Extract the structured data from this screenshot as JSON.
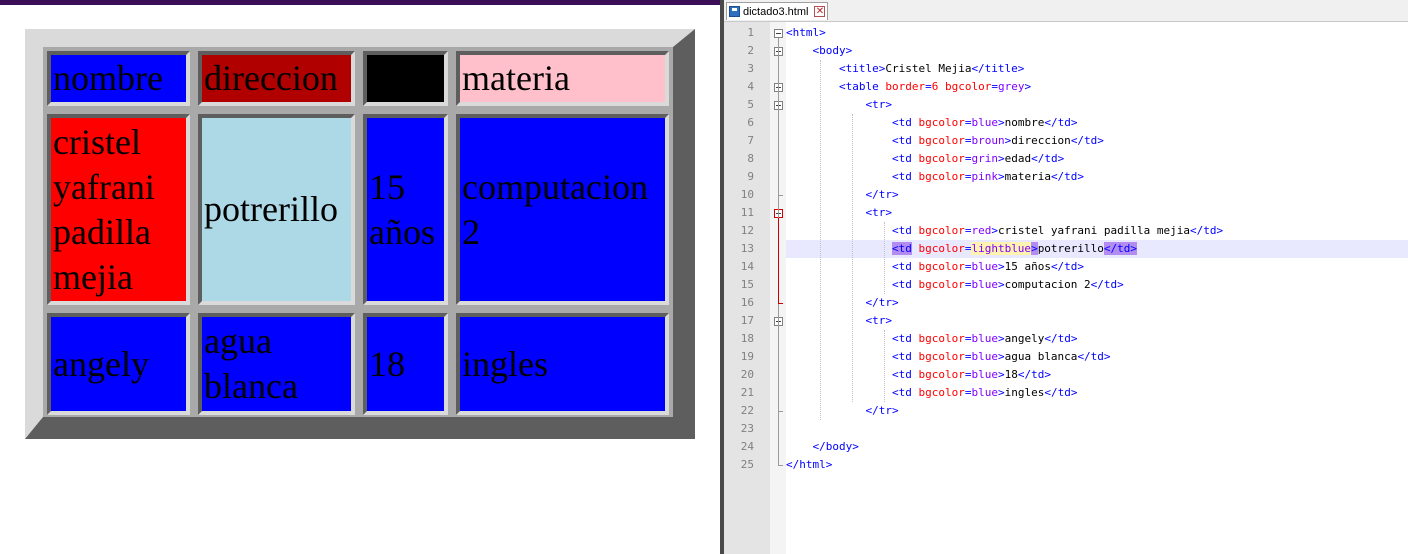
{
  "rendered_table": {
    "rows": [
      [
        {
          "text": "nombre",
          "bg": "#0000ff"
        },
        {
          "text": "direccion",
          "bg": "#b00000"
        },
        {
          "text": "",
          "bg": "#000000"
        },
        {
          "text": "materia",
          "bg": "#ffc0cb"
        }
      ],
      [
        {
          "text": "cristel\nyafrani\npadilla\nmejia",
          "bg": "#ff0000"
        },
        {
          "text": "potrerillo",
          "bg": "#add8e6"
        },
        {
          "text": "15\naños",
          "bg": "#0000ff"
        },
        {
          "text": "computacion\n2",
          "bg": "#0000ff"
        }
      ],
      [
        {
          "text": "angely",
          "bg": "#0000ff"
        },
        {
          "text": "agua\nblanca",
          "bg": "#0000ff"
        },
        {
          "text": "18",
          "bg": "#0000ff"
        },
        {
          "text": "ingles",
          "bg": "#0000ff"
        }
      ]
    ]
  },
  "editor": {
    "tab_title": "dictado3.html",
    "current_line": 13,
    "lines": [
      {
        "n": "1",
        "segs": [
          {
            "t": "<html>",
            "c": "tag"
          }
        ]
      },
      {
        "n": "2",
        "segs": [
          {
            "t": "    "
          },
          {
            "t": "<body>",
            "c": "tag"
          }
        ]
      },
      {
        "n": "3",
        "segs": [
          {
            "t": "        "
          },
          {
            "t": "<title>",
            "c": "tag"
          },
          {
            "t": "Cristel Mejia"
          },
          {
            "t": "</title>",
            "c": "tag"
          }
        ]
      },
      {
        "n": "4",
        "segs": [
          {
            "t": "        "
          },
          {
            "t": "<table ",
            "c": "tag"
          },
          {
            "t": "border",
            "c": "attr"
          },
          {
            "t": "=",
            "c": "tag"
          },
          {
            "t": "6",
            "c": "attr"
          },
          {
            "t": " ",
            "c": "tag"
          },
          {
            "t": "bgcolor",
            "c": "attr"
          },
          {
            "t": "=",
            "c": "tag"
          },
          {
            "t": "grey",
            "c": "val"
          },
          {
            "t": ">",
            "c": "tag"
          }
        ]
      },
      {
        "n": "5",
        "segs": [
          {
            "t": "            "
          },
          {
            "t": "<tr>",
            "c": "tag"
          }
        ]
      },
      {
        "n": "6",
        "segs": [
          {
            "t": "                "
          },
          {
            "t": "<td ",
            "c": "tag"
          },
          {
            "t": "bgcolor",
            "c": "attr"
          },
          {
            "t": "=",
            "c": "tag"
          },
          {
            "t": "blue",
            "c": "val"
          },
          {
            "t": ">",
            "c": "tag"
          },
          {
            "t": "nombre"
          },
          {
            "t": "</td>",
            "c": "tag"
          }
        ]
      },
      {
        "n": "7",
        "segs": [
          {
            "t": "                "
          },
          {
            "t": "<td ",
            "c": "tag"
          },
          {
            "t": "bgcolor",
            "c": "attr"
          },
          {
            "t": "=",
            "c": "tag"
          },
          {
            "t": "broun",
            "c": "val"
          },
          {
            "t": ">",
            "c": "tag"
          },
          {
            "t": "direccion"
          },
          {
            "t": "</td>",
            "c": "tag"
          }
        ]
      },
      {
        "n": "8",
        "segs": [
          {
            "t": "                "
          },
          {
            "t": "<td ",
            "c": "tag"
          },
          {
            "t": "bgcolor",
            "c": "attr"
          },
          {
            "t": "=",
            "c": "tag"
          },
          {
            "t": "grin",
            "c": "val"
          },
          {
            "t": ">",
            "c": "tag"
          },
          {
            "t": "edad"
          },
          {
            "t": "</td>",
            "c": "tag"
          }
        ]
      },
      {
        "n": "9",
        "segs": [
          {
            "t": "                "
          },
          {
            "t": "<td ",
            "c": "tag"
          },
          {
            "t": "bgcolor",
            "c": "attr"
          },
          {
            "t": "=",
            "c": "tag"
          },
          {
            "t": "pink",
            "c": "val"
          },
          {
            "t": ">",
            "c": "tag"
          },
          {
            "t": "materia"
          },
          {
            "t": "</td>",
            "c": "tag"
          }
        ]
      },
      {
        "n": "10",
        "segs": [
          {
            "t": "            "
          },
          {
            "t": "</tr>",
            "c": "tag"
          }
        ]
      },
      {
        "n": "11",
        "segs": [
          {
            "t": "            "
          },
          {
            "t": "<tr>",
            "c": "tag"
          }
        ]
      },
      {
        "n": "12",
        "segs": [
          {
            "t": "                "
          },
          {
            "t": "<td ",
            "c": "tag"
          },
          {
            "t": "bgcolor",
            "c": "attr"
          },
          {
            "t": "=",
            "c": "tag"
          },
          {
            "t": "red",
            "c": "val"
          },
          {
            "t": ">",
            "c": "tag"
          },
          {
            "t": "cristel yafrani padilla mejia"
          },
          {
            "t": "</td>",
            "c": "tag"
          }
        ]
      },
      {
        "n": "13",
        "segs": [
          {
            "t": "                "
          },
          {
            "t": "<td",
            "c": "tag-hl"
          },
          {
            "t": " ",
            "c": "tag"
          },
          {
            "t": "bgcolor",
            "c": "attr"
          },
          {
            "t": "=",
            "c": "tag"
          },
          {
            "t": "lightblue",
            "c": "val"
          },
          {
            "t": ">",
            "c": "tag-hl"
          },
          {
            "t": "potrerillo"
          },
          {
            "t": "</td>",
            "c": "tag-hl"
          }
        ]
      },
      {
        "n": "14",
        "segs": [
          {
            "t": "                "
          },
          {
            "t": "<td ",
            "c": "tag"
          },
          {
            "t": "bgcolor",
            "c": "attr"
          },
          {
            "t": "=",
            "c": "tag"
          },
          {
            "t": "blue",
            "c": "val"
          },
          {
            "t": ">",
            "c": "tag"
          },
          {
            "t": "15 años"
          },
          {
            "t": "</td>",
            "c": "tag"
          }
        ]
      },
      {
        "n": "15",
        "segs": [
          {
            "t": "                "
          },
          {
            "t": "<td ",
            "c": "tag"
          },
          {
            "t": "bgcolor",
            "c": "attr"
          },
          {
            "t": "=",
            "c": "tag"
          },
          {
            "t": "blue",
            "c": "val"
          },
          {
            "t": ">",
            "c": "tag"
          },
          {
            "t": "computacion 2"
          },
          {
            "t": "</td>",
            "c": "tag"
          }
        ]
      },
      {
        "n": "16",
        "segs": [
          {
            "t": "            "
          },
          {
            "t": "</tr>",
            "c": "tag"
          }
        ]
      },
      {
        "n": "17",
        "segs": [
          {
            "t": "            "
          },
          {
            "t": "<tr>",
            "c": "tag"
          }
        ]
      },
      {
        "n": "18",
        "segs": [
          {
            "t": "                "
          },
          {
            "t": "<td ",
            "c": "tag"
          },
          {
            "t": "bgcolor",
            "c": "attr"
          },
          {
            "t": "=",
            "c": "tag"
          },
          {
            "t": "blue",
            "c": "val"
          },
          {
            "t": ">",
            "c": "tag"
          },
          {
            "t": "angely"
          },
          {
            "t": "</td>",
            "c": "tag"
          }
        ]
      },
      {
        "n": "19",
        "segs": [
          {
            "t": "                "
          },
          {
            "t": "<td ",
            "c": "tag"
          },
          {
            "t": "bgcolor",
            "c": "attr"
          },
          {
            "t": "=",
            "c": "tag"
          },
          {
            "t": "blue",
            "c": "val"
          },
          {
            "t": ">",
            "c": "tag"
          },
          {
            "t": "agua blanca"
          },
          {
            "t": "</td>",
            "c": "tag"
          }
        ]
      },
      {
        "n": "20",
        "segs": [
          {
            "t": "                "
          },
          {
            "t": "<td ",
            "c": "tag"
          },
          {
            "t": "bgcolor",
            "c": "attr"
          },
          {
            "t": "=",
            "c": "tag"
          },
          {
            "t": "blue",
            "c": "val"
          },
          {
            "t": ">",
            "c": "tag"
          },
          {
            "t": "18"
          },
          {
            "t": "</td>",
            "c": "tag"
          }
        ]
      },
      {
        "n": "21",
        "segs": [
          {
            "t": "                "
          },
          {
            "t": "<td ",
            "c": "tag"
          },
          {
            "t": "bgcolor",
            "c": "attr"
          },
          {
            "t": "=",
            "c": "tag"
          },
          {
            "t": "blue",
            "c": "val"
          },
          {
            "t": ">",
            "c": "tag"
          },
          {
            "t": "ingles"
          },
          {
            "t": "</td>",
            "c": "tag"
          }
        ]
      },
      {
        "n": "22",
        "segs": [
          {
            "t": "            "
          },
          {
            "t": "</tr>",
            "c": "tag"
          }
        ]
      },
      {
        "n": "23",
        "segs": []
      },
      {
        "n": "24",
        "segs": [
          {
            "t": "    "
          },
          {
            "t": "</body>",
            "c": "tag"
          }
        ]
      },
      {
        "n": "25",
        "segs": [
          {
            "t": "</html>",
            "c": "tag"
          }
        ]
      }
    ]
  }
}
